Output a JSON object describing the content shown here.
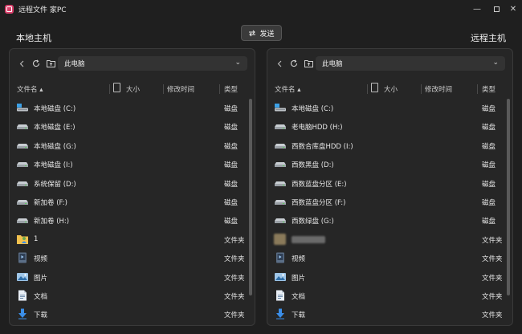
{
  "window": {
    "title": "远程文件 家PC",
    "controls": {
      "minimize": "—",
      "close": "✕"
    }
  },
  "hosts": {
    "local_label": "本地主机",
    "remote_label": "远程主机"
  },
  "send_button": {
    "label": "发送",
    "icon": "swap-arrows-icon"
  },
  "colors": {
    "background": "#1f1f1f",
    "panel": "#262626",
    "accent": "#d8416b",
    "folder_yellow": "#f2c14e",
    "download_blue": "#3b8ee8"
  },
  "columns": {
    "name": "文件名",
    "size": "大小",
    "mtime": "修改时间",
    "type": "类型"
  },
  "left_panel": {
    "path": "此电脑",
    "items": [
      {
        "name": "本地磁盘 (C:)",
        "type": "磁盘",
        "icon": "system-drive-icon"
      },
      {
        "name": "本地磁盘 (E:)",
        "type": "磁盘",
        "icon": "drive-icon"
      },
      {
        "name": "本地磁盘 (G:)",
        "type": "磁盘",
        "icon": "drive-icon"
      },
      {
        "name": "本地磁盘 (I:)",
        "type": "磁盘",
        "icon": "drive-icon"
      },
      {
        "name": "系统保留 (D:)",
        "type": "磁盘",
        "icon": "drive-icon"
      },
      {
        "name": "新加卷 (F:)",
        "type": "磁盘",
        "icon": "drive-icon"
      },
      {
        "name": "新加卷 (H:)",
        "type": "磁盘",
        "icon": "drive-icon"
      },
      {
        "name": "1",
        "type": "文件夹",
        "icon": "user-folder-icon"
      },
      {
        "name": "视频",
        "type": "文件夹",
        "icon": "video-folder-icon"
      },
      {
        "name": "图片",
        "type": "文件夹",
        "icon": "pictures-folder-icon"
      },
      {
        "name": "文档",
        "type": "文件夹",
        "icon": "documents-folder-icon"
      },
      {
        "name": "下载",
        "type": "文件夹",
        "icon": "downloads-folder-icon"
      }
    ]
  },
  "right_panel": {
    "path": "此电脑",
    "items": [
      {
        "name": "本地磁盘 (C:)",
        "type": "磁盘",
        "icon": "system-drive-icon"
      },
      {
        "name": "老电脑HDD (H:)",
        "type": "磁盘",
        "icon": "drive-icon"
      },
      {
        "name": "西数合库盘HDD (I:)",
        "type": "磁盘",
        "icon": "drive-icon"
      },
      {
        "name": "西数黑盘 (D:)",
        "type": "磁盘",
        "icon": "drive-icon"
      },
      {
        "name": "西数蓝盘分区 (E:)",
        "type": "磁盘",
        "icon": "drive-icon"
      },
      {
        "name": "西数蓝盘分区 (F:)",
        "type": "磁盘",
        "icon": "drive-icon"
      },
      {
        "name": "西数绿盘 (G:)",
        "type": "磁盘",
        "icon": "drive-icon"
      },
      {
        "name": "",
        "type": "文件夹",
        "icon": "blurred-folder-icon",
        "blurred": true
      },
      {
        "name": "视频",
        "type": "文件夹",
        "icon": "video-folder-icon"
      },
      {
        "name": "图片",
        "type": "文件夹",
        "icon": "pictures-folder-icon"
      },
      {
        "name": "文档",
        "type": "文件夹",
        "icon": "documents-folder-icon"
      },
      {
        "name": "下载",
        "type": "文件夹",
        "icon": "downloads-folder-icon"
      }
    ]
  }
}
